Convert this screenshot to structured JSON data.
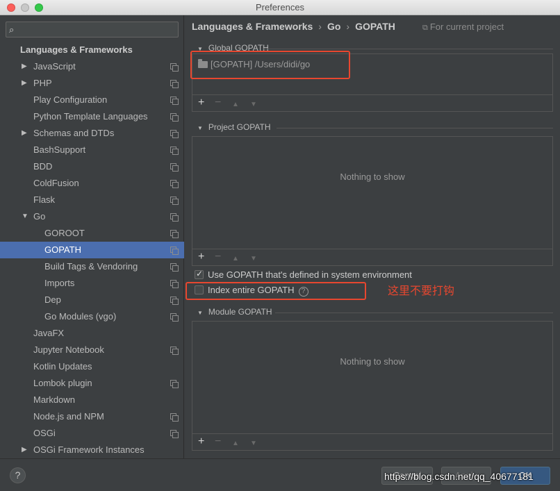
{
  "window": {
    "title": "Preferences"
  },
  "search": {
    "placeholder": ""
  },
  "sidebar": {
    "items": [
      {
        "label": "Languages & Frameworks",
        "level": 0,
        "arrow": "",
        "copy": false,
        "selected": false
      },
      {
        "label": "JavaScript",
        "level": 1,
        "arrow": "right",
        "copy": true,
        "selected": false
      },
      {
        "label": "PHP",
        "level": 1,
        "arrow": "right",
        "copy": true,
        "selected": false
      },
      {
        "label": "Play Configuration",
        "level": 1,
        "arrow": "",
        "copy": true,
        "selected": false
      },
      {
        "label": "Python Template Languages",
        "level": 1,
        "arrow": "",
        "copy": true,
        "selected": false
      },
      {
        "label": "Schemas and DTDs",
        "level": 1,
        "arrow": "right",
        "copy": true,
        "selected": false
      },
      {
        "label": "BashSupport",
        "level": 1,
        "arrow": "",
        "copy": true,
        "selected": false
      },
      {
        "label": "BDD",
        "level": 1,
        "arrow": "",
        "copy": true,
        "selected": false
      },
      {
        "label": "ColdFusion",
        "level": 1,
        "arrow": "",
        "copy": true,
        "selected": false
      },
      {
        "label": "Flask",
        "level": 1,
        "arrow": "",
        "copy": true,
        "selected": false
      },
      {
        "label": "Go",
        "level": 1,
        "arrow": "down",
        "copy": true,
        "selected": false
      },
      {
        "label": "GOROOT",
        "level": 2,
        "arrow": "",
        "copy": true,
        "selected": false
      },
      {
        "label": "GOPATH",
        "level": 2,
        "arrow": "",
        "copy": true,
        "selected": true
      },
      {
        "label": "Build Tags & Vendoring",
        "level": 2,
        "arrow": "",
        "copy": true,
        "selected": false
      },
      {
        "label": "Imports",
        "level": 2,
        "arrow": "",
        "copy": true,
        "selected": false
      },
      {
        "label": "Dep",
        "level": 2,
        "arrow": "",
        "copy": true,
        "selected": false
      },
      {
        "label": "Go Modules (vgo)",
        "level": 2,
        "arrow": "",
        "copy": true,
        "selected": false
      },
      {
        "label": "JavaFX",
        "level": 1,
        "arrow": "",
        "copy": false,
        "selected": false
      },
      {
        "label": "Jupyter Notebook",
        "level": 1,
        "arrow": "",
        "copy": true,
        "selected": false
      },
      {
        "label": "Kotlin Updates",
        "level": 1,
        "arrow": "",
        "copy": false,
        "selected": false
      },
      {
        "label": "Lombok plugin",
        "level": 1,
        "arrow": "",
        "copy": true,
        "selected": false
      },
      {
        "label": "Markdown",
        "level": 1,
        "arrow": "",
        "copy": false,
        "selected": false
      },
      {
        "label": "Node.js and NPM",
        "level": 1,
        "arrow": "",
        "copy": true,
        "selected": false
      },
      {
        "label": "OSGi",
        "level": 1,
        "arrow": "",
        "copy": true,
        "selected": false
      },
      {
        "label": "OSGi Framework Instances",
        "level": 1,
        "arrow": "right",
        "copy": false,
        "selected": false
      }
    ]
  },
  "breadcrumb": {
    "part1": "Languages & Frameworks",
    "sep1": "›",
    "part2": "Go",
    "sep2": "›",
    "part3": "GOPATH"
  },
  "scope": {
    "label": "For current project"
  },
  "global_gopath": {
    "title": "Global GOPATH",
    "entry": "[GOPATH] /Users/didi/go"
  },
  "project_gopath": {
    "title": "Project GOPATH",
    "empty": "Nothing to show"
  },
  "options": {
    "use_system_gopath": {
      "label": "Use GOPATH that's defined in system environment",
      "checked": true
    },
    "index_entire_gopath": {
      "label": "Index entire GOPATH",
      "checked": false
    }
  },
  "module_gopath": {
    "title": "Module GOPATH",
    "empty": "Nothing to show"
  },
  "toolbar": {
    "add": "+",
    "remove": "−",
    "up": "▲",
    "down": "▼"
  },
  "annotation": {
    "text": "这里不要打钩"
  },
  "buttons": {
    "help": "?",
    "cancel": "Cancel",
    "apply": "Apply",
    "ok": "OK"
  },
  "watermark": {
    "text": "https://blog.csdn.net/qq_40677181"
  },
  "colors": {
    "selection": "#4b6eaf",
    "annotation": "#e8472f",
    "ok_button": "#365880"
  }
}
